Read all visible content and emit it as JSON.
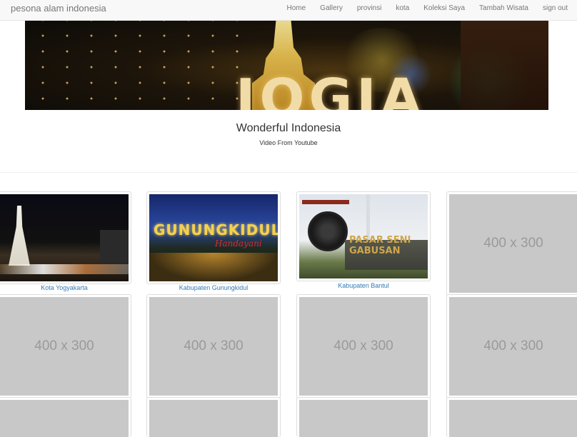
{
  "brand": "pesona alam indonesia",
  "nav": [
    {
      "label": "Home"
    },
    {
      "label": "Gallery"
    },
    {
      "label": "provinsi"
    },
    {
      "label": "kota"
    },
    {
      "label": "Koleksi Saya"
    },
    {
      "label": "Tambah Wisata"
    },
    {
      "label": "sign out"
    }
  ],
  "hero": {
    "image_text": "JOGJA"
  },
  "caption": {
    "title": "Wonderful Indonesia",
    "subtitle": "Video From Youtube"
  },
  "gallery": [
    {
      "label": "Kota Yogyakarta",
      "image": "tugu-yogyakarta-night-photo"
    },
    {
      "label": "Kabupaten Gunungkidul",
      "image": "gunungkidul-sign-night-photo",
      "image_text": "GUNUNGKIDUL",
      "image_subtext": "Handayani"
    },
    {
      "label": "Kabupaten Bantul",
      "image": "pasar-seni-gabusan-gong-photo",
      "image_text": "PASAR SENI GABUSAN"
    },
    {
      "placeholder": "400 x 300"
    },
    {
      "placeholder": "400 x 300"
    },
    {
      "placeholder": "400 x 300"
    },
    {
      "placeholder": "400 x 300"
    },
    {
      "placeholder": "400 x 300"
    }
  ],
  "colors": {
    "link": "#337ab7",
    "navbar_bg": "#f8f8f8",
    "placeholder_bg": "#c8c8c8"
  }
}
